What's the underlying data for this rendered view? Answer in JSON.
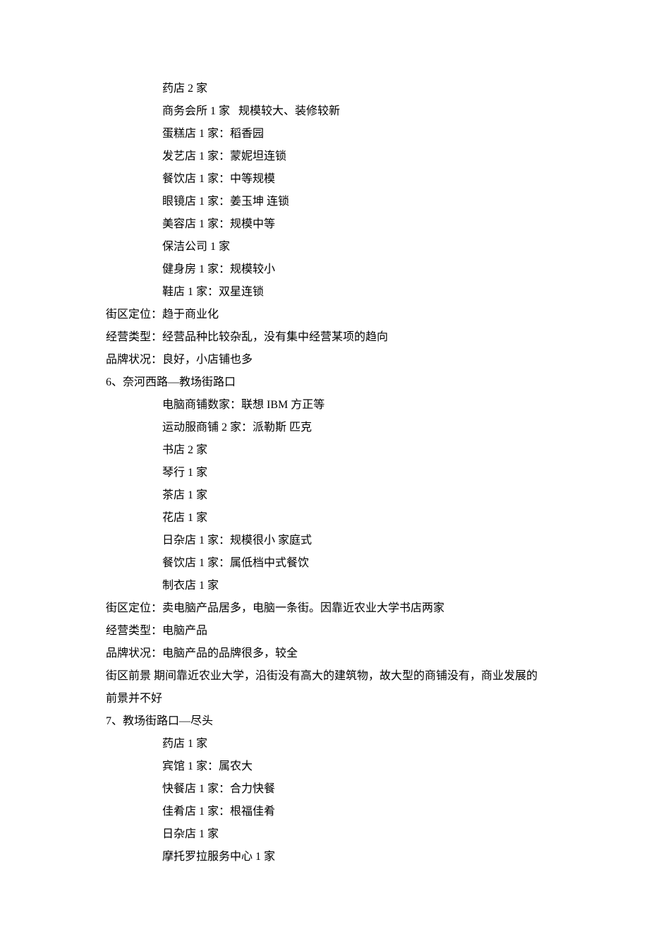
{
  "lines": [
    {
      "indent": 1,
      "text": "药店 2 家"
    },
    {
      "indent": 1,
      "text": "商务会所 1 家   规模较大、装修较新"
    },
    {
      "indent": 1,
      "text": "蛋糕店 1 家：稻香园"
    },
    {
      "indent": 1,
      "text": "发艺店 1 家：蒙妮坦连锁"
    },
    {
      "indent": 1,
      "text": "餐饮店 1 家：中等规模"
    },
    {
      "indent": 1,
      "text": "眼镜店 1 家：姜玉坤 连锁"
    },
    {
      "indent": 1,
      "text": "美容店 1 家：规模中等"
    },
    {
      "indent": 1,
      "text": "保洁公司 1 家"
    },
    {
      "indent": 1,
      "text": "健身房 1 家：规模较小"
    },
    {
      "indent": 1,
      "text": "鞋店 1 家：双星连锁"
    },
    {
      "indent": 0,
      "text": "街区定位：趋于商业化"
    },
    {
      "indent": 0,
      "text": "经营类型：经营品种比较杂乱，没有集中经营某项的趋向"
    },
    {
      "indent": 0,
      "text": "品牌状况：良好，小店铺也多"
    },
    {
      "indent": 0,
      "text": "6、奈河西路—教场街路口"
    },
    {
      "indent": 1,
      "text": "电脑商铺数家：联想 IBM 方正等"
    },
    {
      "indent": 1,
      "text": "运动服商铺 2 家：派勒斯 匹克"
    },
    {
      "indent": 1,
      "text": "书店 2 家"
    },
    {
      "indent": 1,
      "text": "琴行 1 家"
    },
    {
      "indent": 1,
      "text": "茶店 1 家"
    },
    {
      "indent": 1,
      "text": "花店 1 家"
    },
    {
      "indent": 1,
      "text": "日杂店 1 家：规模很小 家庭式"
    },
    {
      "indent": 1,
      "text": "餐饮店 1 家：属低档中式餐饮"
    },
    {
      "indent": 1,
      "text": "制衣店 1 家"
    },
    {
      "indent": 0,
      "text": "街区定位：卖电脑产品居多，电脑一条街。因靠近农业大学书店两家"
    },
    {
      "indent": 0,
      "text": "经营类型：电脑产品"
    },
    {
      "indent": 0,
      "text": "品牌状况：电脑产品的品牌很多，较全"
    },
    {
      "indent": 0,
      "text": "街区前景 期间靠近农业大学，沿街没有高大的建筑物，故大型的商铺没有，商业发展的前景并不好"
    },
    {
      "indent": 0,
      "text": "7、教场街路口—尽头"
    },
    {
      "indent": 1,
      "text": "药店 1 家"
    },
    {
      "indent": 1,
      "text": "宾馆 1 家：属农大"
    },
    {
      "indent": 1,
      "text": "快餐店 1 家：合力快餐"
    },
    {
      "indent": 1,
      "text": "佳肴店 1 家：根福佳肴"
    },
    {
      "indent": 1,
      "text": "日杂店 1 家"
    },
    {
      "indent": 1,
      "text": "摩托罗拉服务中心 1 家"
    }
  ]
}
